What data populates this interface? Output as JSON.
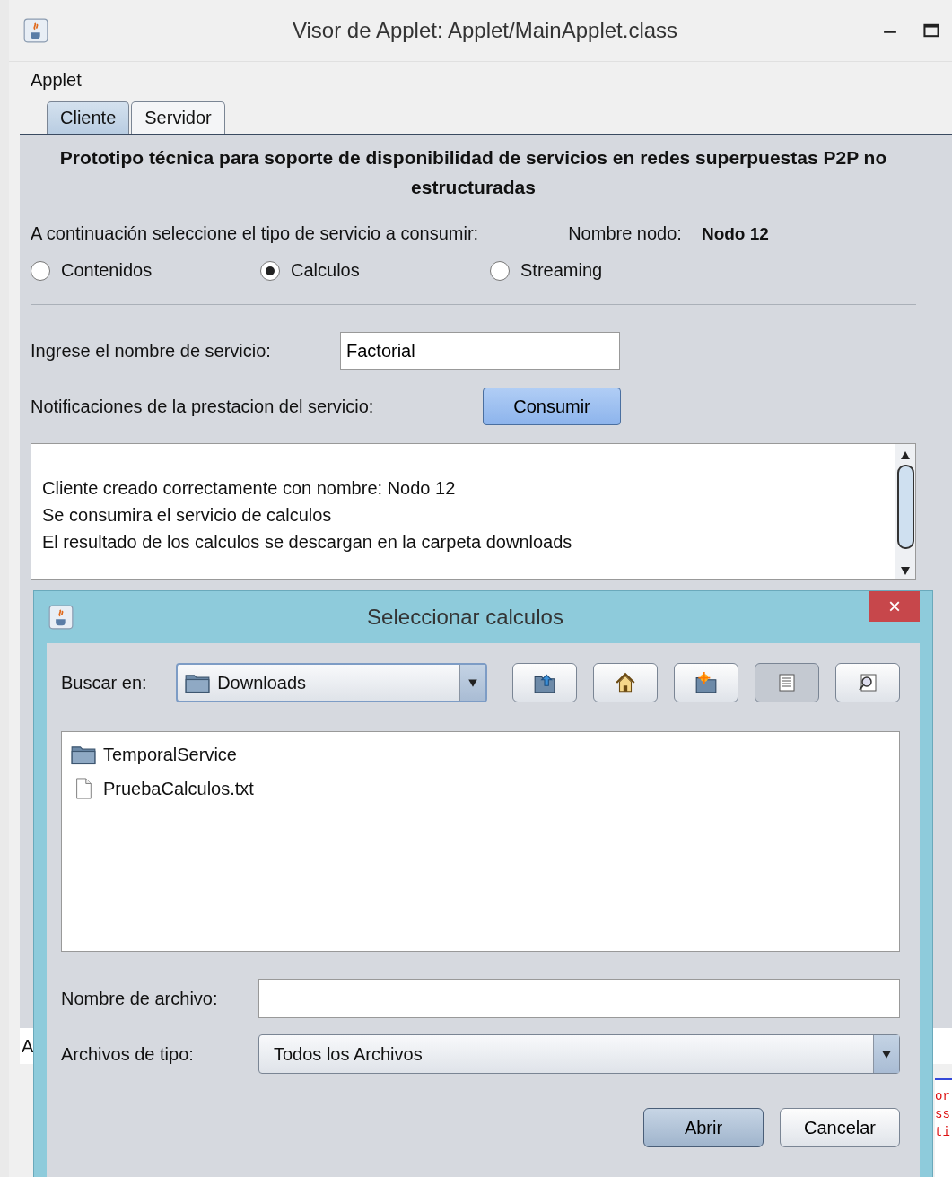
{
  "window": {
    "title": "Visor de Applet: Applet/MainApplet.class"
  },
  "menu": [
    "Applet"
  ],
  "tabs": [
    {
      "label": "Cliente",
      "selected": true
    },
    {
      "label": "Servidor",
      "selected": false
    }
  ],
  "heading": "Prototipo técnica para soporte de disponibilidad de servicios en redes superpuestas P2P no estructuradas",
  "instruction": "A continuación seleccione el tipo de servicio a consumir:",
  "node": {
    "label": "Nombre nodo:",
    "value": "Nodo 12"
  },
  "service_types": [
    {
      "label": "Contenidos",
      "selected": false
    },
    {
      "label": "Calculos",
      "selected": true
    },
    {
      "label": "Streaming",
      "selected": false
    }
  ],
  "service_name": {
    "label": "Ingrese el nombre de servicio:",
    "value": "Factorial"
  },
  "notifications": {
    "label": "Notificaciones de la prestacion del servicio:",
    "button": "Consumir"
  },
  "log": [
    "Cliente creado correctamente con nombre: Nodo 12",
    "Se consumira el servicio de calculos",
    "El resultado de los calculos se descargan en la carpeta downloads"
  ],
  "status_bar": "A",
  "console_fragments": [
    "or",
    "ss",
    "ti"
  ],
  "dialog": {
    "title": "Seleccionar calculos",
    "close": "×",
    "look_in": {
      "label": "Buscar en:",
      "value": "Downloads"
    },
    "toolbar": [
      {
        "kind": "up",
        "selected": false
      },
      {
        "kind": "home",
        "selected": false
      },
      {
        "kind": "new-folder",
        "selected": false
      },
      {
        "kind": "list",
        "selected": true
      },
      {
        "kind": "details",
        "selected": false
      }
    ],
    "files": [
      {
        "name": "TemporalService",
        "kind": "folder"
      },
      {
        "name": "PruebaCalculos.txt",
        "kind": "file"
      }
    ],
    "file_name": {
      "label": "Nombre de archivo:"
    },
    "file_type": {
      "label": "Archivos de tipo:",
      "value": "Todos los Archivos"
    },
    "buttons": [
      {
        "label": "Abrir",
        "kind": "default"
      },
      {
        "label": "Cancelar",
        "kind": "normal"
      }
    ]
  }
}
